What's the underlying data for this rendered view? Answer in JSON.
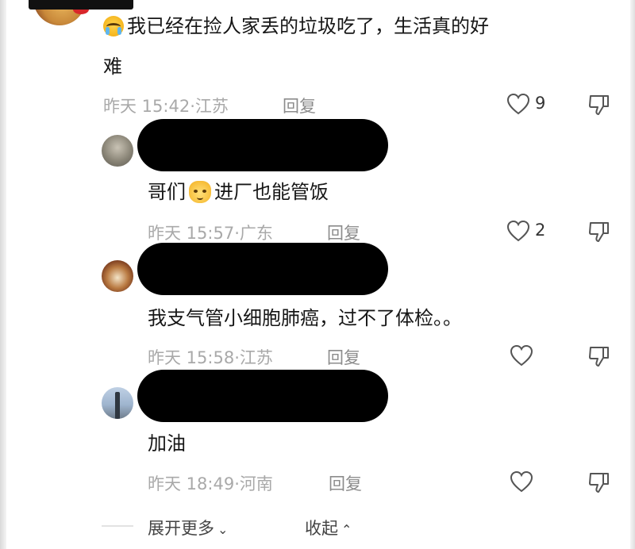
{
  "comments": [
    {
      "text_line1": "我已经在捡人家丢的垃圾吃了，生活真的好",
      "text_line2": "难",
      "time": "昨天 15:42·江苏",
      "reply_label": "回复",
      "likes": "9",
      "emoji": "loudly-crying-face"
    },
    {
      "text_before": "哥们",
      "text_after": "进厂也能管饭",
      "time": "昨天 15:57·广东",
      "reply_label": "回复",
      "likes": "2",
      "emoji": "flushed-face"
    },
    {
      "text": "我支气管小细胞肺癌，过不了体检。。",
      "time": "昨天 15:58·江苏",
      "reply_label": "回复",
      "likes": ""
    },
    {
      "text": "加油",
      "time": "昨天 18:49·河南",
      "reply_label": "回复",
      "likes": ""
    }
  ],
  "footer": {
    "expand_label": "展开更多",
    "collapse_label": "收起"
  },
  "colors": {
    "text": "#161616",
    "meta": "#a9a9a9",
    "redaction": "#000000"
  }
}
